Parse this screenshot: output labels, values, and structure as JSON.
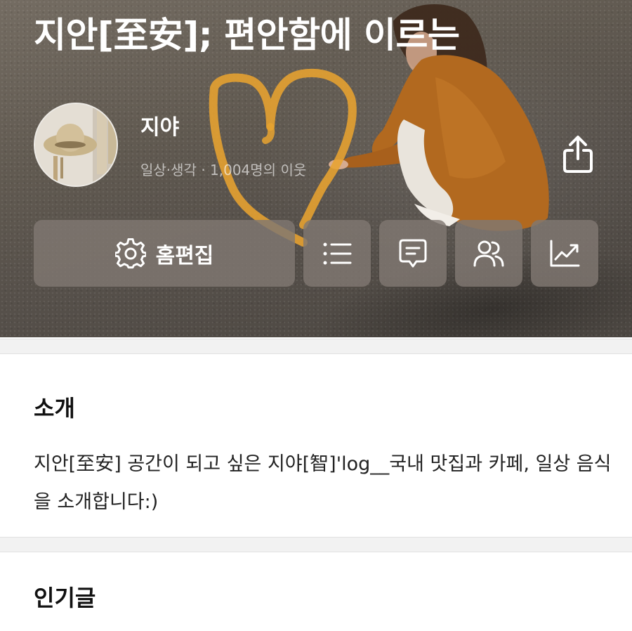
{
  "blog": {
    "title": "지안[至安]; 편안함에 이르는",
    "nickname": "지야",
    "meta": "일상·생각 · 1,004명의 이웃"
  },
  "actions": {
    "edit_label": "홈편집",
    "icons": [
      "gear-icon",
      "list-icon",
      "message-icon",
      "neighbors-icon",
      "stats-icon",
      "share-icon"
    ]
  },
  "intro": {
    "heading": "소개",
    "text": "지안[至安] 공간이 되고 싶은 지야[智]'log__국내 맛집과 카페, 일상 음식을 소개합니다:)"
  },
  "popular": {
    "heading": "인기글"
  },
  "colors": {
    "heart": "#e8a330",
    "button_bg": "#807872",
    "divider": "#f2f2f2"
  }
}
